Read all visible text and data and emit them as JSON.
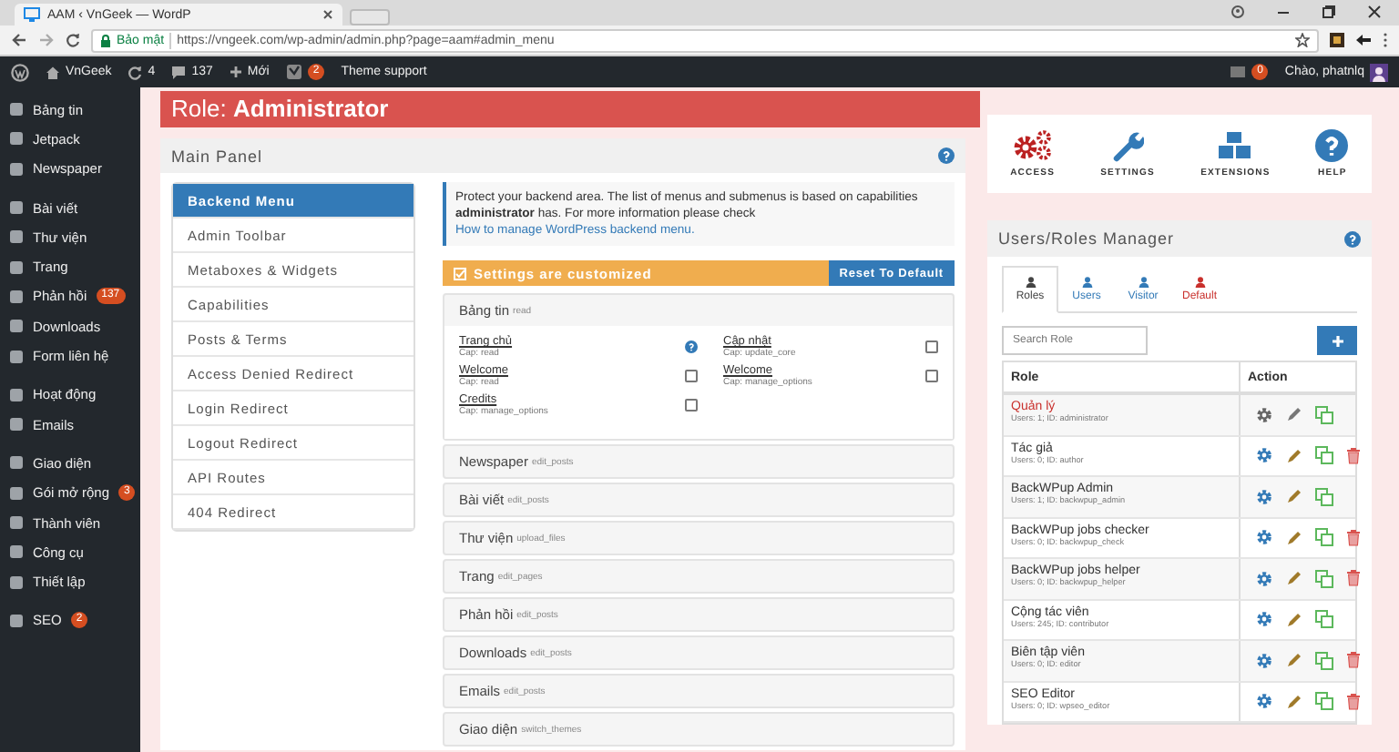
{
  "browser": {
    "tab_title": "AAM ‹ VnGeek — WordP",
    "secure_label": "Bảo mật",
    "url": "https://vngeek.com/wp-admin/admin.php?page=aam#admin_menu"
  },
  "admin_bar": {
    "site": "VnGeek",
    "updates": "4",
    "comments": "137",
    "new": "Mới",
    "seo_badge": "2",
    "theme_support": "Theme support",
    "notifications": "0",
    "greeting": "Chào, phatnlq"
  },
  "sidebar": {
    "groups": [
      {
        "items": [
          {
            "label": "Bảng tin"
          },
          {
            "label": "Jetpack"
          },
          {
            "label": "Newspaper"
          }
        ]
      },
      {
        "items": [
          {
            "label": "Bài viết"
          },
          {
            "label": "Thư viện"
          },
          {
            "label": "Trang"
          },
          {
            "label": "Phản hồi",
            "badge": "137"
          },
          {
            "label": "Downloads"
          },
          {
            "label": "Form liên hệ"
          }
        ]
      },
      {
        "items": [
          {
            "label": "Hoạt động"
          },
          {
            "label": "Emails"
          }
        ]
      },
      {
        "items": [
          {
            "label": "Giao diện"
          },
          {
            "label": "Gói mở rộng",
            "badge": "3"
          },
          {
            "label": "Thành viên"
          },
          {
            "label": "Công cụ"
          },
          {
            "label": "Thiết lập"
          }
        ]
      },
      {
        "items": [
          {
            "label": "SEO",
            "badge": "2"
          }
        ]
      }
    ]
  },
  "role_header": "Role: **Administrator**",
  "main_panel": {
    "title": "Main Panel",
    "menu": [
      {
        "label": "Backend Menu",
        "selected": true
      },
      {
        "label": "Admin Toolbar",
        "selected": false
      },
      {
        "label": "Metaboxes & Widgets",
        "selected": false
      },
      {
        "label": "Capabilities",
        "selected": false
      },
      {
        "label": "Posts & Terms",
        "selected": false
      },
      {
        "label": "Access Denied Redirect",
        "selected": false
      },
      {
        "label": "Login Redirect",
        "selected": false
      },
      {
        "label": "Logout Redirect",
        "selected": false
      },
      {
        "label": "API Routes",
        "selected": false
      },
      {
        "label": "404 Redirect",
        "selected": false
      }
    ],
    "info": {
      "text": "Protect your backend area. The list of menus and submenus is based on capabilities **administrator** has. For more information please check",
      "link": "How to manage WordPress backend menu."
    },
    "status": {
      "label": "Settings are customized",
      "button": "Reset To Default"
    },
    "open_section": {
      "name": "Bảng tin",
      "cap": "read",
      "items": [
        {
          "label": "Trang chủ",
          "cap": "Cap: read",
          "kind": "locked"
        },
        {
          "label": "Cập nhật",
          "cap": "Cap: update_core",
          "kind": "checkbox",
          "checked": false
        },
        {
          "label": "Welcome",
          "cap": "Cap: read",
          "kind": "checkbox",
          "checked": false
        },
        {
          "label": "Welcome",
          "cap": "Cap: manage_options",
          "kind": "checkbox",
          "checked": false
        },
        {
          "label": "Credits",
          "cap": "Cap: manage_options",
          "kind": "checkbox",
          "checked": false
        }
      ]
    },
    "sections": [
      {
        "name": "Newspaper",
        "cap": "edit_posts"
      },
      {
        "name": "Bài viết",
        "cap": "edit_posts"
      },
      {
        "name": "Thư viện",
        "cap": "upload_files"
      },
      {
        "name": "Trang",
        "cap": "edit_pages"
      },
      {
        "name": "Phản hồi",
        "cap": "edit_posts"
      },
      {
        "name": "Downloads",
        "cap": "edit_posts"
      },
      {
        "name": "Emails",
        "cap": "edit_posts"
      },
      {
        "name": "Giao diện",
        "cap": "switch_themes"
      }
    ]
  },
  "shortcuts": [
    {
      "label": "ACCESS",
      "kind": "access"
    },
    {
      "label": "SETTINGS",
      "kind": "settings"
    },
    {
      "label": "EXTENSIONS",
      "kind": "extensions"
    },
    {
      "label": "HELP",
      "kind": "help"
    }
  ],
  "roles_manager": {
    "title": "Users/Roles Manager",
    "tabs": [
      {
        "label": "Roles",
        "selected": true,
        "color": "#444444"
      },
      {
        "label": "Users",
        "selected": false,
        "color": "#337ab7"
      },
      {
        "label": "Visitor",
        "selected": false,
        "color": "#337ab7"
      },
      {
        "label": "Default",
        "selected": false,
        "color": "#c9302c"
      }
    ],
    "search": {
      "placeholder": "Search Role"
    },
    "columns": [
      "Role",
      "Action"
    ],
    "rows": [
      {
        "name": "Quản lý",
        "meta": "Users: 1; ID: administrator",
        "current": true,
        "deletable": false
      },
      {
        "name": "Tác giả",
        "meta": "Users: 0; ID: author",
        "current": false,
        "deletable": true
      },
      {
        "name": "BackWPup Admin",
        "meta": "Users: 1; ID: backwpup_admin",
        "current": false,
        "deletable": false
      },
      {
        "name": "BackWPup jobs checker",
        "meta": "Users: 0; ID: backwpup_check",
        "current": false,
        "deletable": true
      },
      {
        "name": "BackWPup jobs helper",
        "meta": "Users: 0; ID: backwpup_helper",
        "current": false,
        "deletable": true
      },
      {
        "name": "Cộng tác viên",
        "meta": "Users: 245; ID: contributor",
        "current": false,
        "deletable": false
      },
      {
        "name": "Biên tập viên",
        "meta": "Users: 0; ID: editor",
        "current": false,
        "deletable": true
      },
      {
        "name": "SEO Editor",
        "meta": "Users: 0; ID: wpseo_editor",
        "current": false,
        "deletable": true
      }
    ]
  }
}
